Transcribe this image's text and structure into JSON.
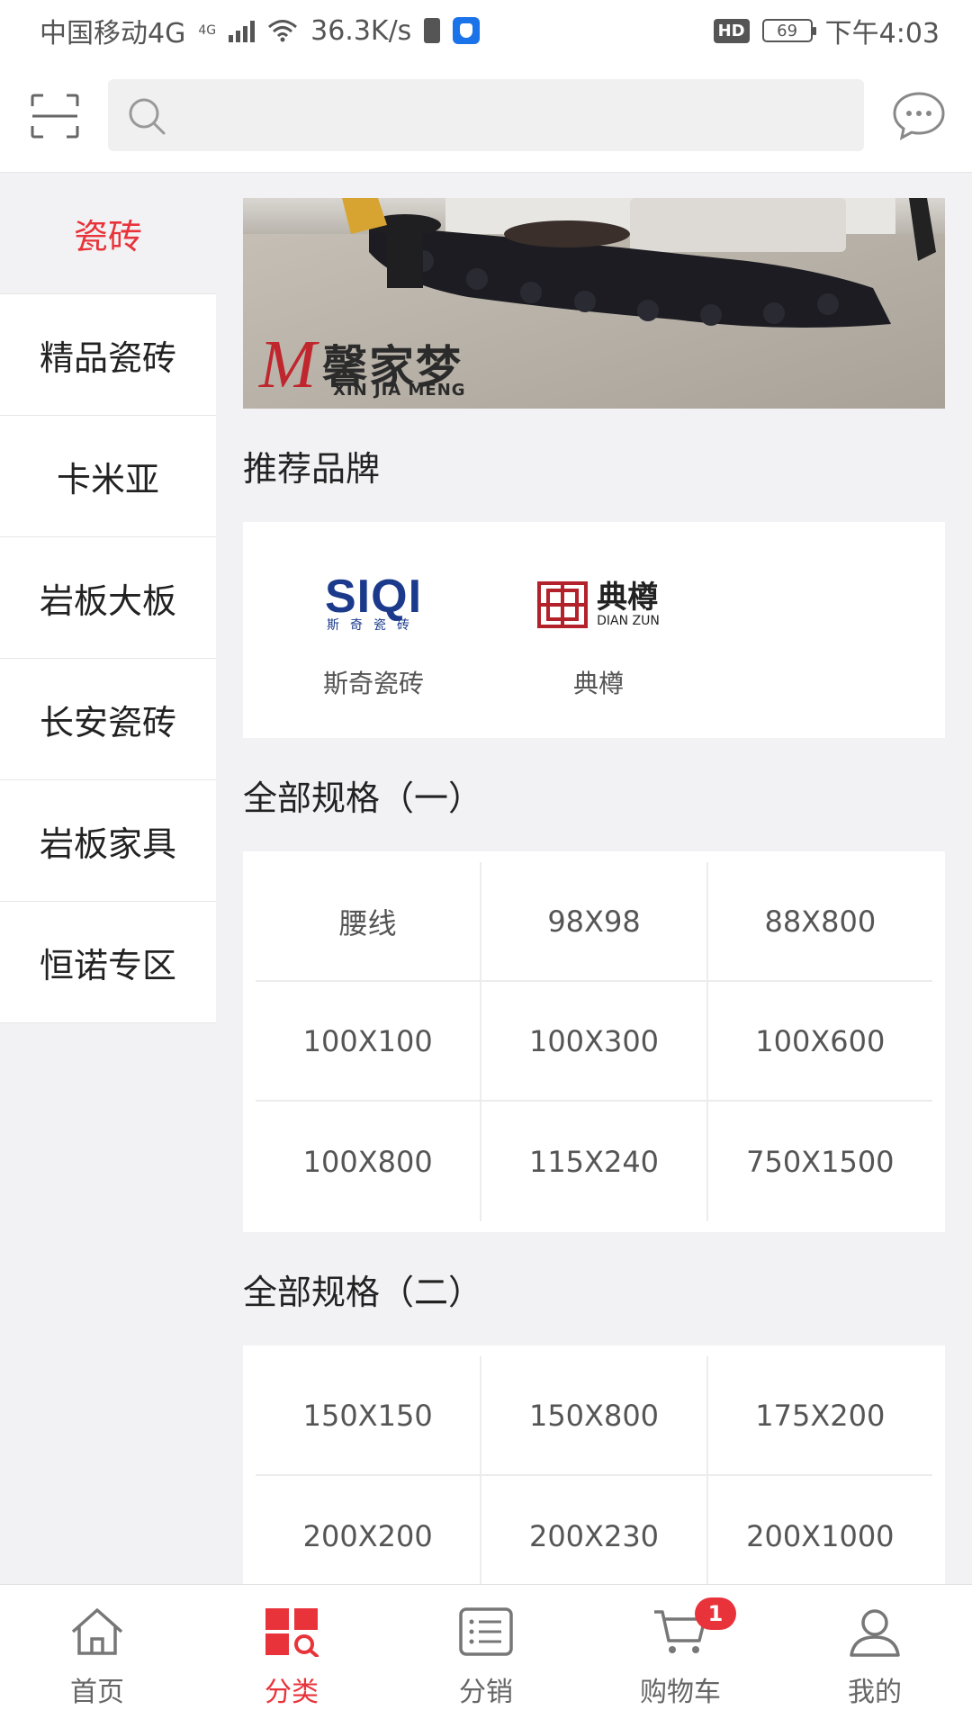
{
  "status_bar": {
    "carrier": "中国移动4G",
    "net_badge": "4G",
    "speed": "36.3K/s",
    "hd": "HD",
    "battery": "69",
    "time": "下午4:03"
  },
  "header": {
    "search": {
      "placeholder": ""
    },
    "scan_icon": "scan-icon",
    "message_icon": "chat-bubble-icon"
  },
  "sidebar": {
    "items": [
      {
        "label": "瓷砖",
        "active": true
      },
      {
        "label": "精品瓷砖",
        "active": false
      },
      {
        "label": "卡米亚",
        "active": false
      },
      {
        "label": "岩板大板",
        "active": false
      },
      {
        "label": "长安瓷砖",
        "active": false
      },
      {
        "label": "岩板家具",
        "active": false
      },
      {
        "label": "恒诺专区",
        "active": false
      }
    ]
  },
  "banner": {
    "brand_cn": "馨家梦",
    "brand_en": "XIN JIA MENG"
  },
  "recommended_brands": {
    "title": "推荐品牌",
    "brands": [
      {
        "logo_text": "SIQI",
        "logo_sub": "斯奇瓷砖",
        "name": "斯奇瓷砖"
      },
      {
        "logo_text": "典樽",
        "logo_sub": "DIAN ZUN",
        "name": "典樽"
      }
    ]
  },
  "spec_section_1": {
    "title": "全部规格（一）",
    "rows": [
      [
        "腰线",
        "98X98",
        "88X800"
      ],
      [
        "100X100",
        "100X300",
        "100X600"
      ],
      [
        "100X800",
        "115X240",
        "750X1500"
      ]
    ]
  },
  "spec_section_2": {
    "title": "全部规格（二）",
    "rows": [
      [
        "150X150",
        "150X800",
        "175X200"
      ],
      [
        "200X200",
        "200X230",
        "200X1000"
      ]
    ]
  },
  "tabbar": {
    "tabs": [
      {
        "label": "首页",
        "icon": "home-icon"
      },
      {
        "label": "分类",
        "icon": "category-icon",
        "active": true
      },
      {
        "label": "分销",
        "icon": "list-icon"
      },
      {
        "label": "购物车",
        "icon": "cart-icon",
        "badge": "1"
      },
      {
        "label": "我的",
        "icon": "user-icon"
      }
    ]
  },
  "colors": {
    "accent": "#e8333a",
    "background": "#f2f2f4"
  }
}
